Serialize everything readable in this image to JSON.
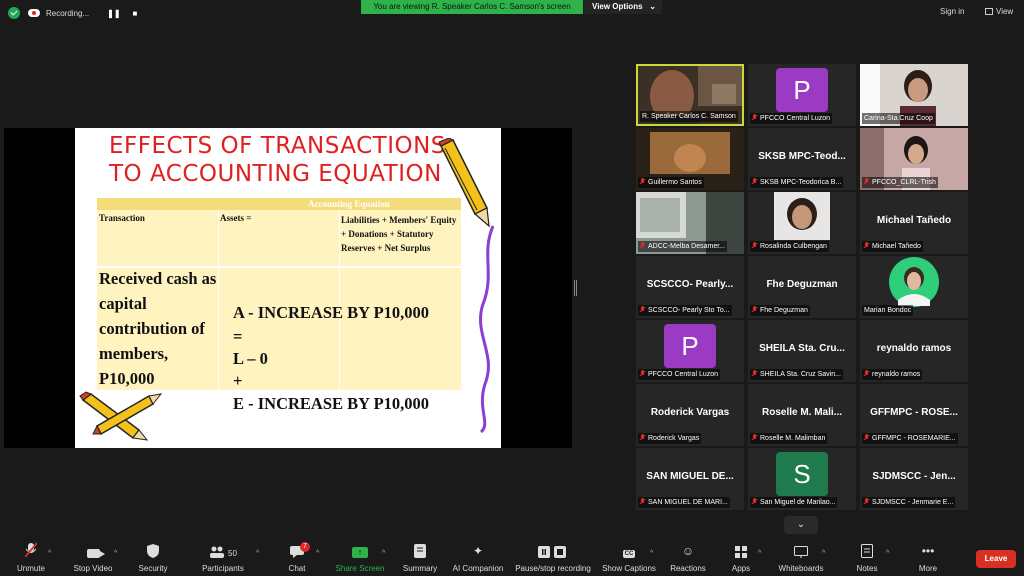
{
  "topbar": {
    "recording_label": "Recording...",
    "pause_glyph": "❚❚",
    "stop_glyph": "■",
    "viewing_banner": "You are viewing R. Speaker Carlos C. Samson's screen",
    "view_options": "View Options",
    "sign_in": "Sign in",
    "view": "View",
    "security_color": "#23a55a",
    "banner_color": "#2db34a"
  },
  "slide": {
    "title_line1": "EFFECTS OF TRANSACTIONS",
    "title_line2": "TO ACCOUNTING EQUATION",
    "table_header": "Accounting Equation",
    "col_transaction": "Transaction",
    "col_assets": "Assets   =",
    "col_liabilities": "Liabilities + Members' Equity + Donations + Statutory Reserves + Net Surplus",
    "description": "Received cash as capital contribution of members, P10,000",
    "eq_a": "A - INCREASE BY P10,000",
    "eq_equals": "=",
    "eq_l": "L – 0",
    "eq_plus": "+",
    "eq_e": "E - INCREASE BY P10,000",
    "title_color": "#e02020"
  },
  "participants": [
    {
      "label": "R. Speaker Carlos C. Samson",
      "kind": "video",
      "muted": false,
      "active": true
    },
    {
      "label": "PFCCO Central Luzon",
      "kind": "letter",
      "letter": "P",
      "bg": "#9b3bc4",
      "muted": true
    },
    {
      "label": "Carina-Sta.Cruz Coop",
      "kind": "video",
      "muted": false
    },
    {
      "label": "Guillermo Santos",
      "kind": "video",
      "muted": true
    },
    {
      "label": "SKSB MPC-Teodorica B...",
      "name": "SKSB MPC-Teod...",
      "kind": "name",
      "muted": true
    },
    {
      "label": "PFCCO_CLRL-Trish",
      "kind": "video",
      "muted": true
    },
    {
      "label": "ADCC-Melba Desamer...",
      "kind": "video",
      "muted": true
    },
    {
      "label": "Rosalinda Culbengan",
      "kind": "video",
      "muted": true
    },
    {
      "label": "Michael Tañedo",
      "name": "Michael Tañedo",
      "kind": "name",
      "muted": true
    },
    {
      "label": "SCSCCO- Pearly Sto To...",
      "name": "SCSCCO-  Pearly...",
      "kind": "name",
      "muted": true
    },
    {
      "label": "Fhe Deguzman",
      "name": "Fhe Deguzman",
      "kind": "name",
      "muted": true
    },
    {
      "label": "Marian Bondoc",
      "kind": "photo",
      "muted": false
    },
    {
      "label": "PFCCO Central Luzon",
      "kind": "letter",
      "letter": "P",
      "bg": "#9b3bc4",
      "muted": true
    },
    {
      "label": "SHEILA Sta. Cruz Savin...",
      "name": "SHEILA Sta. Cru...",
      "kind": "name",
      "muted": true
    },
    {
      "label": "reynaldo ramos",
      "name": "reynaldo ramos",
      "kind": "name",
      "muted": true
    },
    {
      "label": "Roderick Vargas",
      "name": "Roderick Vargas",
      "kind": "name",
      "muted": true
    },
    {
      "label": "Roselle M. Malimban",
      "name": "Roselle  M.  Mali...",
      "kind": "name",
      "muted": true
    },
    {
      "label": "GFFMPC - ROSEMARIE...",
      "name": "GFFMPC  -  ROSE...",
      "kind": "name",
      "muted": true
    },
    {
      "label": "SAN MIGUEL DE MARI...",
      "name": "SAN MIGUEL DE...",
      "kind": "name",
      "muted": true
    },
    {
      "label": "San Miguel de Marilao...",
      "kind": "letter",
      "letter": "S",
      "bg": "#1f7a4d",
      "muted": true
    },
    {
      "label": "SJDMSCC - Jenmarie E...",
      "name": "SJDMSCC  -  Jen...",
      "kind": "name",
      "muted": true
    }
  ],
  "toolbar": {
    "unmute": "Unmute",
    "stop_video": "Stop Video",
    "security": "Security",
    "participants": "Participants",
    "participants_count": "50",
    "chat": "Chat",
    "chat_badge": "7",
    "share_screen": "Share Screen",
    "summary": "Summary",
    "ai_companion": "AI Companion",
    "pause_recording": "Pause/stop recording",
    "show_captions": "Show Captions",
    "reactions": "Reactions",
    "apps": "Apps",
    "whiteboards": "Whiteboards",
    "notes": "Notes",
    "more": "More",
    "leave": "Leave",
    "leave_color": "#d93025"
  }
}
